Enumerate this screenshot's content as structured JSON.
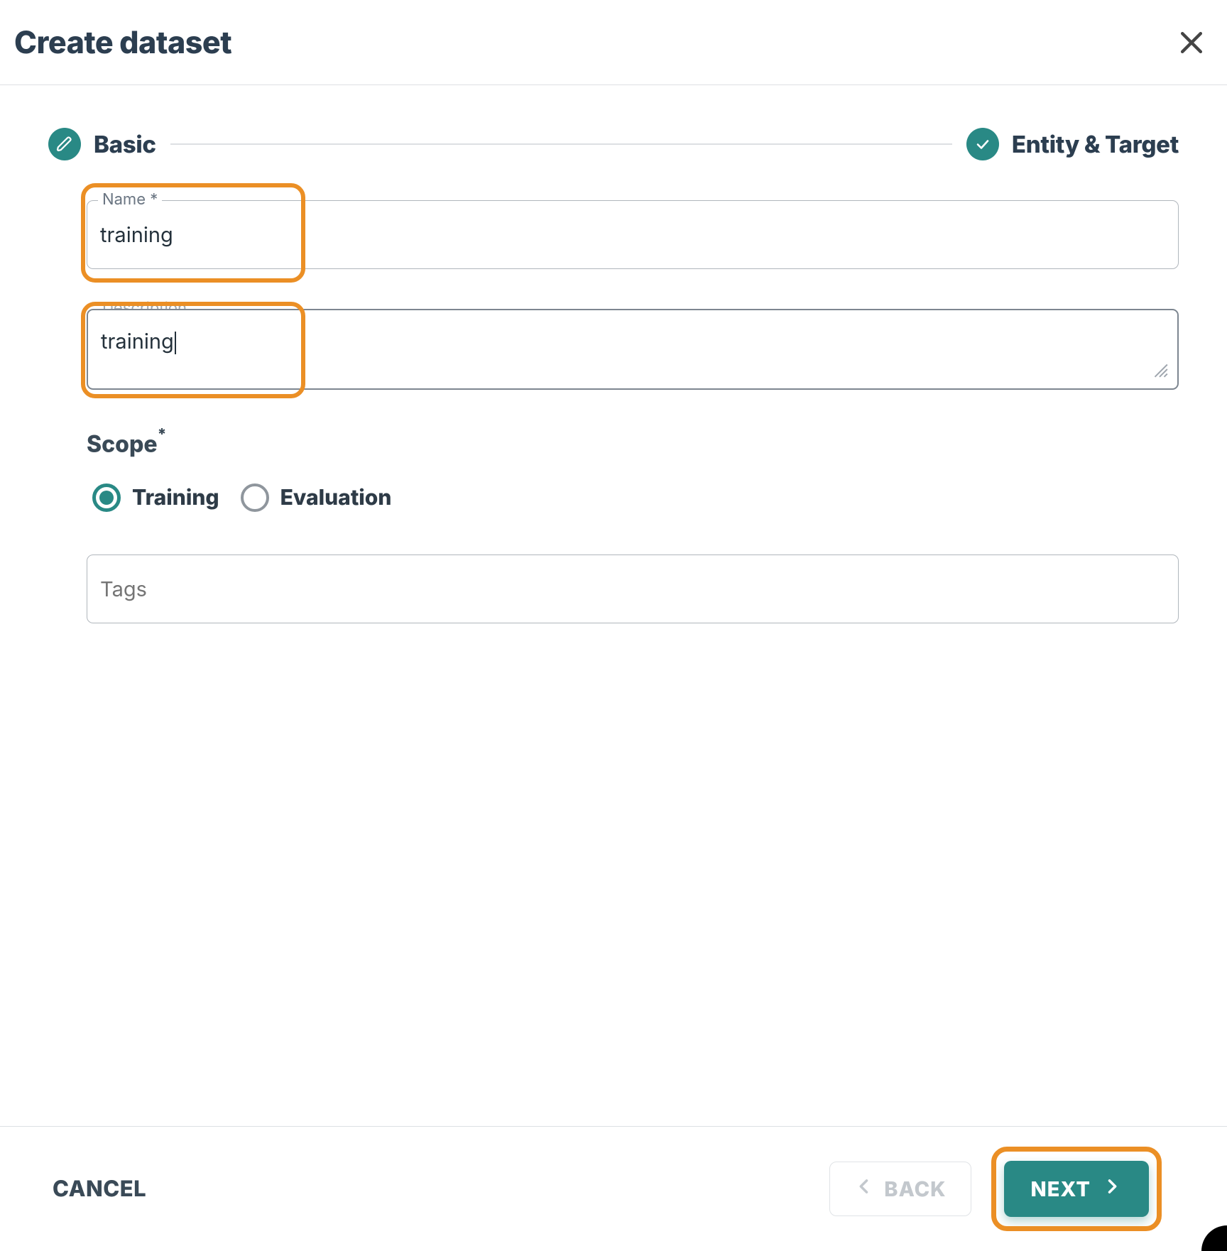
{
  "header": {
    "title": "Create dataset"
  },
  "stepper": {
    "steps": [
      {
        "label": "Basic",
        "icon": "pencil"
      },
      {
        "label": "Entity & Target",
        "icon": "check"
      }
    ]
  },
  "form": {
    "name": {
      "label": "Name *",
      "value": "training"
    },
    "description": {
      "label": "Description",
      "value": "training"
    },
    "scope": {
      "label": "Scope",
      "options": [
        {
          "label": "Training",
          "selected": true
        },
        {
          "label": "Evaluation",
          "selected": false
        }
      ]
    },
    "tags": {
      "placeholder": "Tags"
    }
  },
  "footer": {
    "cancel": "CANCEL",
    "back": "BACK",
    "next": "NEXT"
  }
}
